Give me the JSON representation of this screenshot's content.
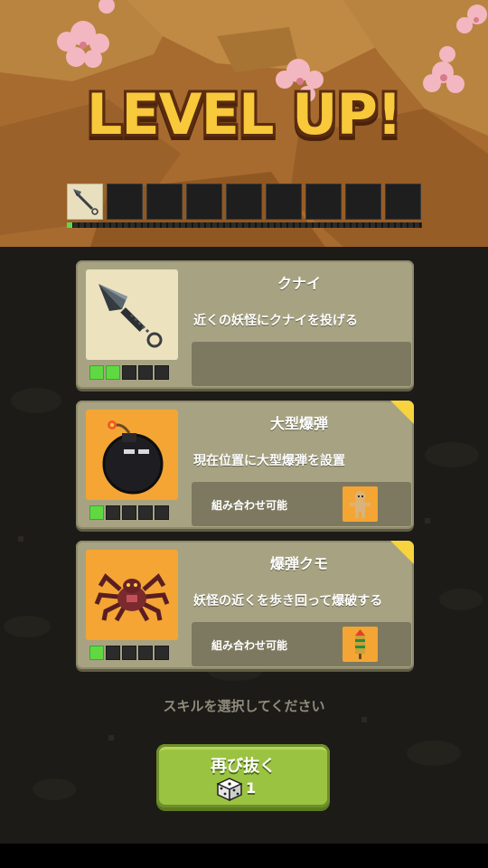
{
  "banner": {
    "title": "LEVEL UP!",
    "slots_total": 9,
    "slots_filled": 1,
    "filled_icon": "kunai-icon"
  },
  "cards": [
    {
      "name": "クナイ",
      "description": "近くの妖怪にクナイを投げる",
      "icon": "kunai-icon",
      "level": 2,
      "max_level": 5,
      "new_badge": false,
      "combo_label": "",
      "combo_icon": ""
    },
    {
      "name": "大型爆弾",
      "description": "現在位置に大型爆弾を設置",
      "icon": "bomb-icon",
      "level": 1,
      "max_level": 5,
      "new_badge": true,
      "combo_label": "組み合わせ可能",
      "combo_icon": "voodoo-doll-icon"
    },
    {
      "name": "爆弾クモ",
      "description": "妖怪の近くを歩き回って爆破する",
      "icon": "spider-icon",
      "level": 1,
      "max_level": 5,
      "new_badge": true,
      "combo_label": "組み合わせ可能",
      "combo_icon": "firework-rocket-icon"
    }
  ],
  "prompt": "スキルを選択してください",
  "reroll": {
    "label": "再び抜く",
    "count": "1",
    "icon": "dice-icon"
  },
  "colors": {
    "title": "#f7c93b",
    "level_on": "#60d843",
    "card_bg": "#a7a382",
    "reroll_bg": "#9bc342",
    "badge": "#f7d33d"
  }
}
